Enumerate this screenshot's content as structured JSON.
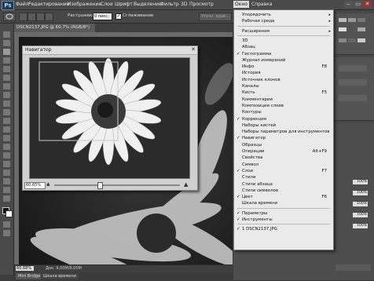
{
  "app": {
    "logo": "Ps"
  },
  "menubar": {
    "items": [
      "Файл",
      "Редактирование",
      "Изображение",
      "Слои",
      "Шрифт",
      "Выделение",
      "Фильтр",
      "3D",
      "Просмотр",
      "Окно",
      "Справка"
    ],
    "active": "Окно",
    "window_controls": [
      "‒",
      "▭",
      "✕"
    ]
  },
  "options": {
    "feather_label": "Растушевка:",
    "feather_value": "0 пикс.",
    "antialias_label": "Сглаживание",
    "refine_label": "Уточн. край..."
  },
  "document": {
    "tab_title": "DSCN2137.JPG @ 60,7% (RGB/8*)",
    "status_zoom": "60,68%",
    "status_doc": "Док: 9,00M/9,00M"
  },
  "navigator": {
    "title": "Навигатор",
    "zoom_value": "60,65%",
    "zoom_level": 0.6065
  },
  "bottom_tabs": [
    "Mini Bridge",
    "Шкала времени"
  ],
  "panels": {
    "values": [
      "100%",
      "100%",
      "100%",
      "100%",
      "100%"
    ]
  },
  "colors": {
    "accent": "#1e3b5a",
    "menu_bg": "#eaeaea",
    "ui_dark": "#3c3c3c"
  },
  "window_menu": {
    "items": [
      {
        "label": "Упорядочить",
        "submenu": true
      },
      {
        "label": "Рабочая среда",
        "submenu": true
      },
      {
        "sep": true
      },
      {
        "label": "Расширения",
        "submenu": true
      },
      {
        "sep": true
      },
      {
        "label": "3D"
      },
      {
        "label": "Абзац"
      },
      {
        "label": "Гистограмма",
        "checked": true
      },
      {
        "label": "Журнал измерений"
      },
      {
        "label": "Инфо",
        "shortcut": "F8"
      },
      {
        "label": "История"
      },
      {
        "label": "Источник клонов"
      },
      {
        "label": "Каналы"
      },
      {
        "label": "Кисть",
        "shortcut": "F5"
      },
      {
        "label": "Комментарии"
      },
      {
        "label": "Композиции слоев"
      },
      {
        "label": "Контуры"
      },
      {
        "label": "Коррекция",
        "checked": true
      },
      {
        "label": "Наборы кистей"
      },
      {
        "label": "Наборы параметров для инструментов"
      },
      {
        "label": "Навигатор",
        "checked": true
      },
      {
        "label": "Образцы"
      },
      {
        "label": "Операции",
        "shortcut": "Alt+F9"
      },
      {
        "label": "Свойства"
      },
      {
        "label": "Символ"
      },
      {
        "label": "Слои",
        "shortcut": "F7",
        "checked": true
      },
      {
        "label": "Стили"
      },
      {
        "label": "Стили абзаца"
      },
      {
        "label": "Стили символов"
      },
      {
        "label": "Цвет",
        "shortcut": "F6",
        "checked": true
      },
      {
        "label": "Шкала времени"
      },
      {
        "sep": true
      },
      {
        "label": "Параметры",
        "checked": true
      },
      {
        "label": "Инструменты",
        "checked": true
      },
      {
        "sep": true
      },
      {
        "label": "1 DSCN2137.JPG",
        "checked": true
      }
    ]
  }
}
